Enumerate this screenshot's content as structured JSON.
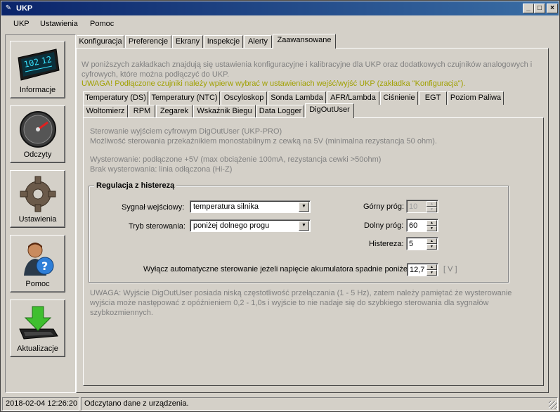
{
  "window": {
    "title": "UKP"
  },
  "menu": [
    "UKP",
    "Ustawienia",
    "Pomoc"
  ],
  "nav": [
    {
      "label": "Informacje",
      "icon": "lcd-display-icon"
    },
    {
      "label": "Odczyty",
      "icon": "gauge-icon"
    },
    {
      "label": "Ustawienia",
      "icon": "gear-icon"
    },
    {
      "label": "Pomoc",
      "icon": "help-person-icon"
    },
    {
      "label": "Aktualizacje",
      "icon": "download-arrow-icon"
    }
  ],
  "lcd": {
    "line1": "102",
    "line2": "12"
  },
  "main_tabs": [
    "Konfiguracja",
    "Preferencje",
    "Ekrany",
    "Inspekcje",
    "Alerty",
    "Zaawansowane"
  ],
  "intro": {
    "text": "W poniższych zakładkach znajdują się ustawienia konfiguracyjne i kalibracyjne dla UKP oraz dodatkowych czujników analogowych i cyfrowych, które można podłączyć do UKP.",
    "warning": "UWAGA! Podłączone czujniki należy wpierw wybrać w ustawieniach wejść/wyjść UKP (zakładka \"Konfiguracja\")."
  },
  "sub_tabs_row1": [
    "Temperatury (DS)",
    "Temperatury (NTC)",
    "Oscyloskop",
    "Sonda Lambda",
    "AFR/Lambda",
    "Ciśnienie",
    "EGT",
    "Poziom Paliwa"
  ],
  "sub_tabs_row2": [
    "Woltomierz",
    "RPM",
    "Zegarek",
    "Wskaźnik Biegu",
    "Data Logger",
    "DigOutUser"
  ],
  "desc": {
    "line1": "Sterowanie wyjściem cyfrowym DigOutUser (UKP-PRO)",
    "line2": "Możliwość sterowania przekaźnikiem monostabilnym z cewką na 5V (minimalna rezystancja 50 ohm).",
    "line3": "Wysterowanie: podłączone +5V (max obciążenie 100mA, rezystancja cewki >50ohm)",
    "line4": "Brak wysterowania: linia odłączona (Hi-Z)"
  },
  "group": {
    "title": "Regulacja z histerezą",
    "input_label": "Sygnał wejściowy:",
    "input_value": "temperatura silnika",
    "mode_label": "Tryb sterowania:",
    "mode_value": "poniżej dolnego progu",
    "upper_label": "Górny próg:",
    "upper_value": "10",
    "lower_label": "Dolny próg:",
    "lower_value": "60",
    "hyst_label": "Histereza:",
    "hyst_value": "5",
    "voltage_label": "Wyłącz automatyczne sterowanie jeżeli napięcie akumulatora spadnie poniżej:",
    "voltage_value": "12,7",
    "voltage_unit": "[ V ]"
  },
  "note": "UWAGA: Wyjście DigOutUser posiada niską częstotliwość przełączania (1 - 5 Hz), zatem należy pamiętać że wysterowanie wyjścia może następować z opóźnieniem 0,2 - 1,0s i wyjście to nie nadaje się do szybkiego sterowania dla sygnałów szybkozmiennych.",
  "status": {
    "timestamp": "2018-02-04 12:26:20",
    "message": "Odczytano dane z urządzenia."
  },
  "colors": {
    "title_start": "#0a246a",
    "title_end": "#3a6ea5",
    "warning": "#a0a000",
    "face": "#d4d0c8"
  }
}
